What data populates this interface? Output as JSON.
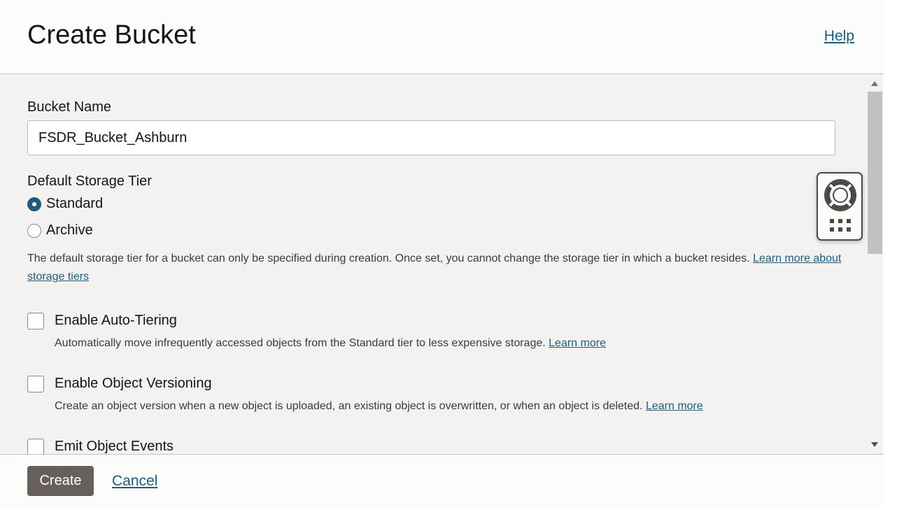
{
  "header": {
    "title": "Create Bucket",
    "help_label": "Help"
  },
  "form": {
    "bucket_name": {
      "label": "Bucket Name",
      "value": "FSDR_Bucket_Ashburn"
    },
    "storage_tier": {
      "label": "Default Storage Tier",
      "options": [
        {
          "label": "Standard",
          "checked": true
        },
        {
          "label": "Archive",
          "checked": false
        }
      ],
      "description": "The default storage tier for a bucket can only be specified during creation. Once set, you cannot change the storage tier in which a bucket resides.",
      "link_label": "Learn more about storage tiers"
    },
    "auto_tiering": {
      "label": "Enable Auto-Tiering",
      "description": "Automatically move infrequently accessed objects from the Standard tier to less expensive storage.",
      "link_label": "Learn more",
      "checked": false
    },
    "object_versioning": {
      "label": "Enable Object Versioning",
      "description": "Create an object version when a new object is uploaded, an existing object is overwritten, or when an object is deleted.",
      "link_label": "Learn more",
      "checked": false
    },
    "object_events": {
      "label": "Emit Object Events",
      "checked": false
    }
  },
  "footer": {
    "create_label": "Create",
    "cancel_label": "Cancel"
  },
  "colors": {
    "accent": "#1f5c7a",
    "primary_button": "#665f5b",
    "panel_bg": "#f3f2f1"
  },
  "icons": {
    "widget_top": "lifebuoy-icon",
    "widget_bottom": "apps-grid-icon"
  }
}
